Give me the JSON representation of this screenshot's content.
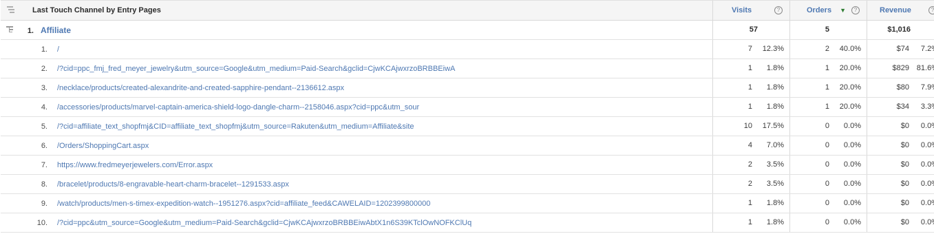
{
  "header": {
    "dimension_label": "Last Touch Channel by Entry Pages",
    "metrics": [
      {
        "label": "Visits",
        "sorted": false
      },
      {
        "label": "Orders",
        "sorted": true
      },
      {
        "label": "Revenue",
        "sorted": false
      }
    ],
    "help_glyph": "?",
    "sort_glyph": "▼"
  },
  "group": {
    "index": "1.",
    "label": "Affiliate",
    "visits": "57",
    "orders": "5",
    "revenue": "$1,016"
  },
  "rows": [
    {
      "index": "1.",
      "page": "/",
      "visits": "7",
      "visits_pct": "12.3%",
      "orders": "2",
      "orders_pct": "40.0%",
      "revenue": "$74",
      "revenue_pct": "7.2%"
    },
    {
      "index": "2.",
      "page": "/?cid=ppc_fmj_fred_meyer_jewelry&utm_source=Google&utm_medium=Paid-Search&gclid=CjwKCAjwxrzoBRBBEiwA",
      "visits": "1",
      "visits_pct": "1.8%",
      "orders": "1",
      "orders_pct": "20.0%",
      "revenue": "$829",
      "revenue_pct": "81.6%"
    },
    {
      "index": "3.",
      "page": "/necklace/products/created-alexandrite-and-created-sapphire-pendant--2136612.aspx",
      "visits": "1",
      "visits_pct": "1.8%",
      "orders": "1",
      "orders_pct": "20.0%",
      "revenue": "$80",
      "revenue_pct": "7.9%"
    },
    {
      "index": "4.",
      "page": "/accessories/products/marvel-captain-america-shield-logo-dangle-charm--2158046.aspx?cid=ppc&utm_sour",
      "visits": "1",
      "visits_pct": "1.8%",
      "orders": "1",
      "orders_pct": "20.0%",
      "revenue": "$34",
      "revenue_pct": "3.3%"
    },
    {
      "index": "5.",
      "page": "/?cid=affiliate_text_shopfmj&CID=affiliate_text_shopfmj&utm_source=Rakuten&utm_medium=Affiliate&site",
      "visits": "10",
      "visits_pct": "17.5%",
      "orders": "0",
      "orders_pct": "0.0%",
      "revenue": "$0",
      "revenue_pct": "0.0%"
    },
    {
      "index": "6.",
      "page": "/Orders/ShoppingCart.aspx",
      "visits": "4",
      "visits_pct": "7.0%",
      "orders": "0",
      "orders_pct": "0.0%",
      "revenue": "$0",
      "revenue_pct": "0.0%"
    },
    {
      "index": "7.",
      "page": "https://www.fredmeyerjewelers.com/Error.aspx",
      "visits": "2",
      "visits_pct": "3.5%",
      "orders": "0",
      "orders_pct": "0.0%",
      "revenue": "$0",
      "revenue_pct": "0.0%"
    },
    {
      "index": "8.",
      "page": "/bracelet/products/8-engravable-heart-charm-bracelet--1291533.aspx",
      "visits": "2",
      "visits_pct": "3.5%",
      "orders": "0",
      "orders_pct": "0.0%",
      "revenue": "$0",
      "revenue_pct": "0.0%"
    },
    {
      "index": "9.",
      "page": "/watch/products/men-s-timex-expedition-watch--1951276.aspx?cid=affiliate_feed&CAWELAID=1202399800000",
      "visits": "1",
      "visits_pct": "1.8%",
      "orders": "0",
      "orders_pct": "0.0%",
      "revenue": "$0",
      "revenue_pct": "0.0%"
    },
    {
      "index": "10.",
      "page": "/?cid=ppc&utm_source=Google&utm_medium=Paid-Search&gclid=CjwKCAjwxrzoBRBBEiwAbtX1n6S39KTclOwNOFKClUq",
      "visits": "1",
      "visits_pct": "1.8%",
      "orders": "0",
      "orders_pct": "0.0%",
      "revenue": "$0",
      "revenue_pct": "0.0%"
    }
  ],
  "colors": {
    "link": "#4e78b2",
    "header_bg": "#f5f5f5",
    "border": "#e1e1e1",
    "sort_arrow": "#2e7d32"
  }
}
